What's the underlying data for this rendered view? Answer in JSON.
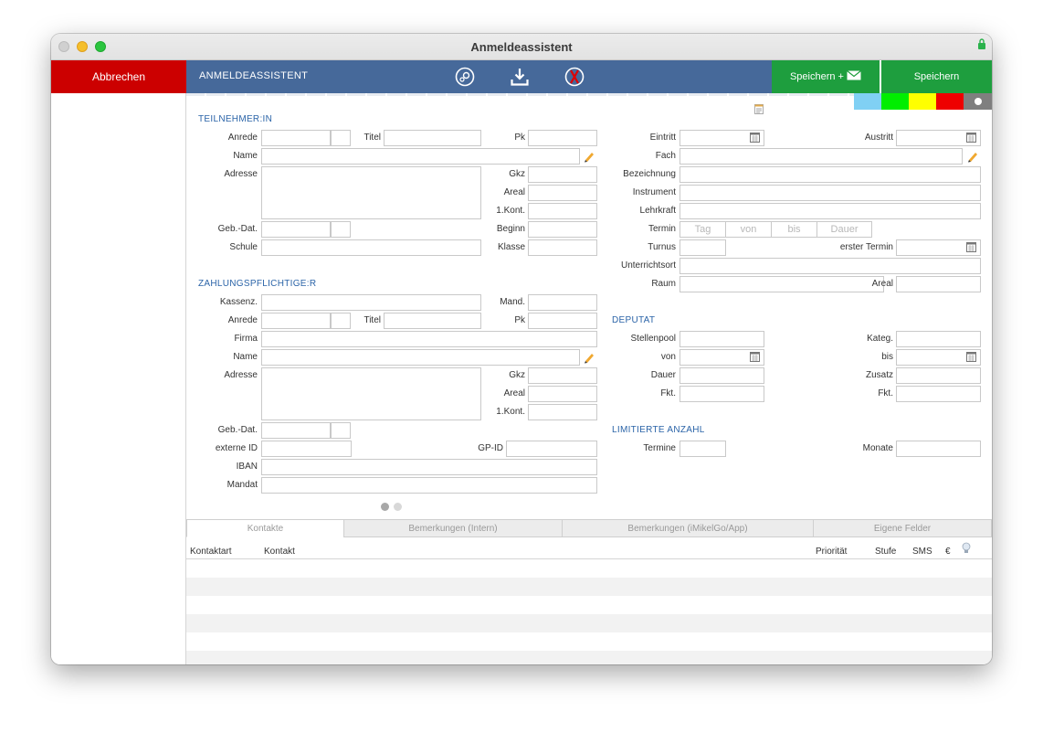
{
  "window": {
    "title": "Anmeldeassistent"
  },
  "toolbar": {
    "cancel_label": "Abbrechen",
    "bar_title": "ANMELDEASSISTENT",
    "save_mail_label": "Speichern +",
    "save_label": "Speichern",
    "icons": [
      "settings-icon",
      "download-icon",
      "no-delete-icon",
      "mail-icon"
    ]
  },
  "color_swatches": [
    "#80d0f4",
    "#00ee00",
    "#ffff00",
    "#ee0000",
    "#7f7f7f"
  ],
  "participant": {
    "heading": "TEILNEHMER:IN",
    "anrede_label": "Anrede",
    "titel_label": "Titel",
    "pk_label": "Pk",
    "name_label": "Name",
    "adresse_label": "Adresse",
    "gkz_label": "Gkz",
    "areal_label": "Areal",
    "kont_label": "1.Kont.",
    "gebdat_label": "Geb.-Dat.",
    "beginn_label": "Beginn",
    "schule_label": "Schule",
    "klasse_label": "Klasse"
  },
  "payer": {
    "heading": "ZAHLUNGSPFLICHTIGE:R",
    "kassenz_label": "Kassenz.",
    "mand_label": "Mand.",
    "anrede_label": "Anrede",
    "titel_label": "Titel",
    "pk_label": "Pk",
    "firma_label": "Firma",
    "name_label": "Name",
    "adresse_label": "Adresse",
    "gkz_label": "Gkz",
    "areal_label": "Areal",
    "kont_label": "1.Kont.",
    "gebdat_label": "Geb.-Dat.",
    "externe_label": "externe ID",
    "gpid_label": "GP-ID",
    "iban_label": "IBAN",
    "mandat_label": "Mandat"
  },
  "course": {
    "eintritt_label": "Eintritt",
    "austritt_label": "Austritt",
    "fach_label": "Fach",
    "bezeichnung_label": "Bezeichnung",
    "instrument_label": "Instrument",
    "lehrkraft_label": "Lehrkraft",
    "termin_label": "Termin",
    "termin_segments": [
      "Tag",
      "von",
      "bis",
      "Dauer"
    ],
    "turnus_label": "Turnus",
    "erster_label": "erster Termin",
    "unterrichtsort_label": "Unterrichtsort",
    "raum_label": "Raum",
    "areal_label": "Areal"
  },
  "deputat": {
    "heading": "DEPUTAT",
    "stellenpool_label": "Stellenpool",
    "kateg_label": "Kateg.",
    "von_label": "von",
    "bis_label": "bis",
    "dauer_label": "Dauer",
    "zusatz_label": "Zusatz",
    "fkt_label": "Fkt.",
    "fkt2_label": "Fkt."
  },
  "limit": {
    "heading": "LIMITIERTE ANZAHL",
    "termine_label": "Termine",
    "monate_label": "Monate"
  },
  "tabs": [
    "Kontakte",
    "Bemerkungen (Intern)",
    "Bemerkungen (iMikelGo/App)",
    "Eigene Felder"
  ],
  "contacts_table": {
    "columns": [
      "Kontaktart",
      "Kontakt",
      "Priorität",
      "Stufe",
      "SMS",
      "€"
    ]
  }
}
